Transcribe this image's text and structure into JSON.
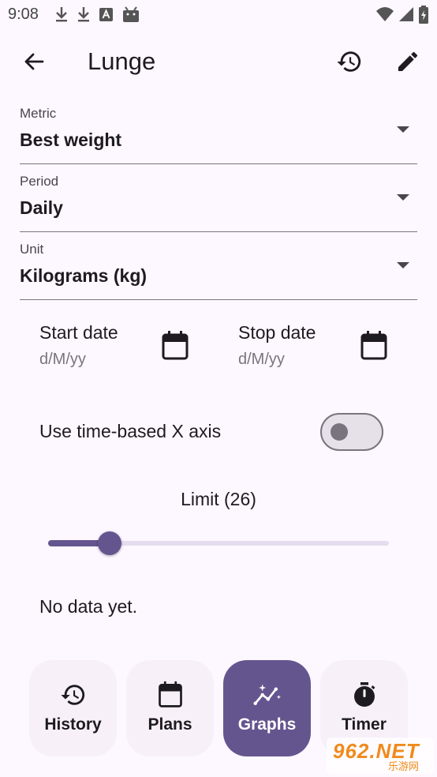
{
  "status_bar": {
    "time": "9:08",
    "left_icons": [
      "download-icon",
      "download-icon",
      "app-a-icon",
      "android-icon"
    ],
    "right_icons": [
      "wifi-icon",
      "signal-icon",
      "battery-icon"
    ]
  },
  "app_bar": {
    "title": "Lunge",
    "icons": [
      "back-arrow-icon",
      "history-icon",
      "edit-pencil-icon"
    ]
  },
  "fields": {
    "metric": {
      "label": "Metric",
      "value": "Best weight"
    },
    "period": {
      "label": "Period",
      "value": "Daily"
    },
    "unit": {
      "label": "Unit",
      "value": "Kilograms (kg)"
    }
  },
  "dates": {
    "start": {
      "label": "Start date",
      "placeholder": "d/M/yy"
    },
    "stop": {
      "label": "Stop date",
      "placeholder": "d/M/yy"
    }
  },
  "time_axis": {
    "label": "Use time-based X axis",
    "enabled": false
  },
  "limit": {
    "label": "Limit (26)",
    "value": 26,
    "fraction": 0.18
  },
  "empty_state": "No data yet.",
  "bottom_nav": [
    {
      "label": "History",
      "icon": "history-icon",
      "active": false
    },
    {
      "label": "Plans",
      "icon": "calendar-icon",
      "active": false
    },
    {
      "label": "Graphs",
      "icon": "graph-sparkle-icon",
      "active": true
    },
    {
      "label": "Timer",
      "icon": "stopwatch-icon",
      "active": false
    }
  ],
  "watermark": {
    "main": "962.NET",
    "sub": "乐游网"
  },
  "colors": {
    "background": "#fdf7ff",
    "accent": "#65558f",
    "outline": "#79747e",
    "text": "#1d1b20"
  }
}
